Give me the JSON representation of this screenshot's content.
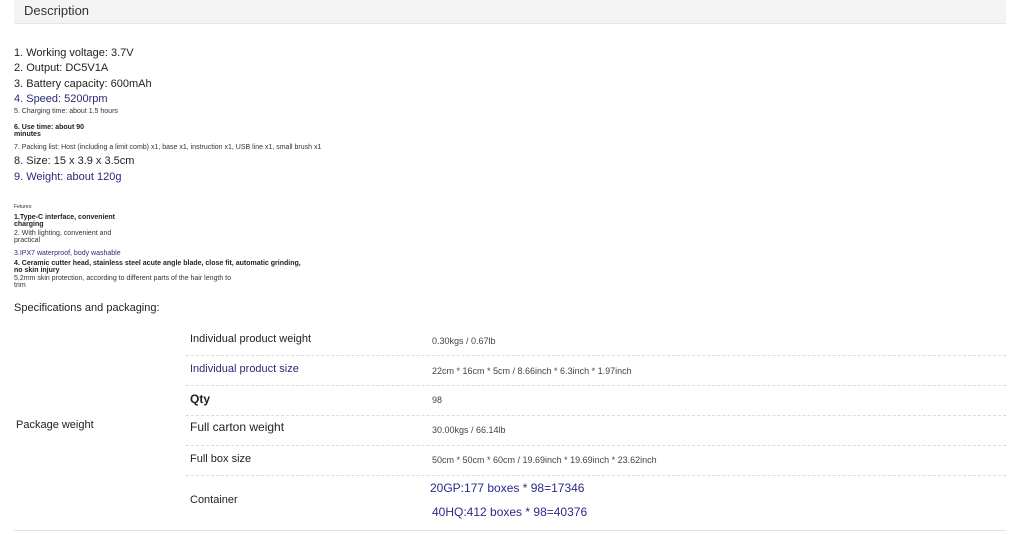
{
  "tab": {
    "label": "Description"
  },
  "specs": {
    "s1": "1. Working voltage: 3.7V",
    "s2": "2. Output: DC5V1A",
    "s3": "3. Battery capacity: 600mAh",
    "s4": "4. Speed: 5200rpm",
    "s5": "5. Charging time: about 1.5 hours",
    "s6": "6. Use time: about 90 minutes",
    "s7": "7. Packing list: Host (including a limit comb) x1, base x1, instruction x1, USB line x1, small brush x1",
    "s8": "8. Size: 15 x 3.9 x 3.5cm",
    "s9": "9. Weight: about 120g"
  },
  "features": {
    "title": "Fetures:",
    "f1": "1.Type-C interface, convenient charging",
    "f2": "2. With lighting, convenient and practical",
    "f3": "3.IPX7 waterproof, body washable",
    "f4": "4. Ceramic cutter head, stainless steel acute angle blade, close fit, automatic grinding, no skin injury",
    "f5": "5.2mm skin protection, according to different parts of the hair length to trim"
  },
  "packaging": {
    "title": "Specifications and packaging:",
    "row_header": "Package weight",
    "rows": [
      {
        "label": "Individual product weight",
        "value": "0.30kgs / 0.67lb"
      },
      {
        "label": "Individual product size",
        "value": "22cm * 16cm * 5cm / 8.66inch * 6.3inch * 1.97inch"
      },
      {
        "label": "Qty",
        "value": "98"
      },
      {
        "label": "Full carton weight",
        "value": "30.00kgs / 66.14lb"
      },
      {
        "label": "Full box size",
        "value": "50cm * 50cm * 60cm / 19.69inch * 19.69inch * 23.62inch"
      },
      {
        "label": "Container",
        "value": "20GP:177 boxes * 98=17346",
        "value2": "40HQ:412 boxes * 98=40376"
      }
    ]
  }
}
